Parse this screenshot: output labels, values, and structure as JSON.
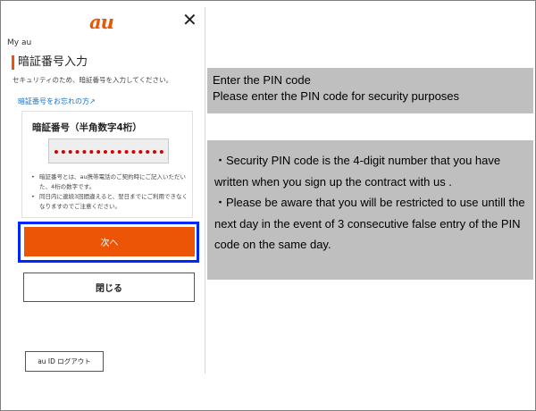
{
  "phone": {
    "logo": "au",
    "close_icon": "✕",
    "my_au": "My au",
    "title": "暗証番号入力",
    "subtitle": "セキュリティのため、暗証番号を入力してください。",
    "forgot_link": "暗証番号をお忘れの方",
    "forgot_link_icon": "↗",
    "field_label": "暗証番号（半角数字4桁）",
    "notes": [
      "暗証番号とは、au携帯電話のご契約時にご記入いただいた、4桁の数字です。",
      "同日内に連続3回間違えると、翌日までにご利用できなくなりますのでご注意ください。"
    ],
    "next_button": "次へ",
    "close_button": "閉じる",
    "logout_button": "au ID ログアウト"
  },
  "info_top": {
    "line1": "Enter the PIN code",
    "line2": "Please enter the PIN code for security purposes"
  },
  "info_bottom": {
    "para1": "・Security PIN code is the 4-digit number that you have written when you sign up the contract with us .",
    "para2": "・Please be aware that you will be restricted to use untill the next day in the event of 3 consecutive false entry of the PIN code on the same day."
  },
  "colors": {
    "accent": "#eb5505",
    "highlight_outline": "#0026ff",
    "link": "#1a6fc4",
    "panel_gray": "#bfbfbf"
  }
}
